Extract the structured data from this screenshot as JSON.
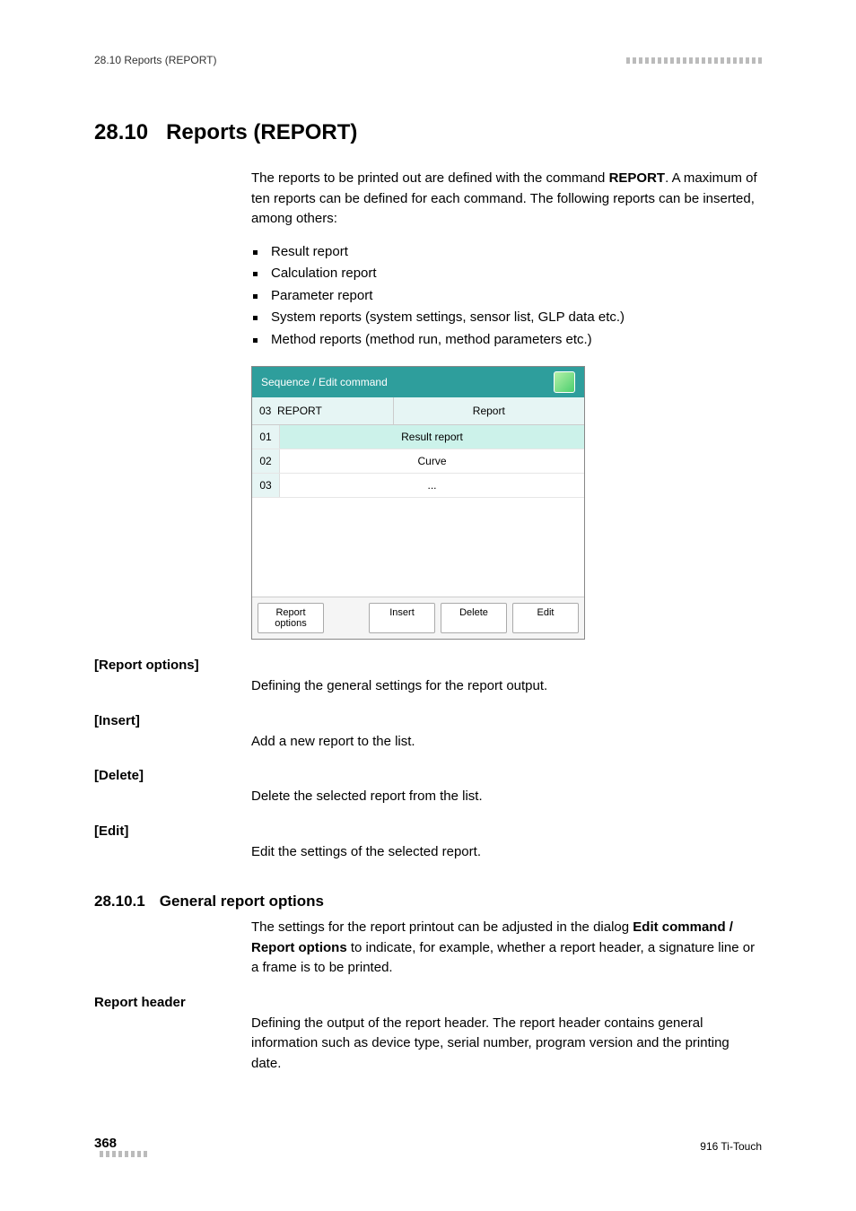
{
  "header": {
    "breadcrumb": "28.10 Reports (REPORT)"
  },
  "h1": {
    "num": "28.10",
    "title": "Reports (REPORT)"
  },
  "intro": {
    "pre": "The reports to be printed out are defined with the command ",
    "cmd": "REPORT",
    "post": ". A maximum of ten reports can be defined for each command. The following reports can be inserted, among others:"
  },
  "report_types": [
    "Result report",
    "Calculation report",
    "Parameter report",
    "System reports (system settings, sensor list, GLP data etc.)",
    "Method reports (method run, method parameters etc.)"
  ],
  "dialog": {
    "title": "Sequence / Edit command",
    "sub_left_num": "03",
    "sub_left_cmd": "REPORT",
    "sub_right": "Report",
    "rows": [
      {
        "idx": "01",
        "val": "Result report",
        "selected": true
      },
      {
        "idx": "02",
        "val": "Curve",
        "selected": false
      },
      {
        "idx": "03",
        "val": "...",
        "selected": false
      }
    ],
    "buttons": {
      "report_options_l1": "Report",
      "report_options_l2": "options",
      "insert": "Insert",
      "delete": "Delete",
      "edit": "Edit"
    }
  },
  "definitions": [
    {
      "term": "[Report options]",
      "body": "Defining the general settings for the report output."
    },
    {
      "term": "[Insert]",
      "body": "Add a new report to the list."
    },
    {
      "term": "[Delete]",
      "body": "Delete the selected report from the list."
    },
    {
      "term": "[Edit]",
      "body": "Edit the settings of the selected report."
    }
  ],
  "h2": {
    "num": "28.10.1",
    "title": "General report options"
  },
  "section": {
    "pre": "The settings for the report printout can be adjusted in the dialog ",
    "b1": "Edit command / Report options",
    "post": " to indicate, for example, whether a report header, a signature line or a frame is to be printed."
  },
  "report_header": {
    "term": "Report header",
    "body": "Defining the output of the report header. The report header contains general information such as device type, serial number, program version and the printing date."
  },
  "footer": {
    "page": "368",
    "product": "916 Ti-Touch"
  }
}
